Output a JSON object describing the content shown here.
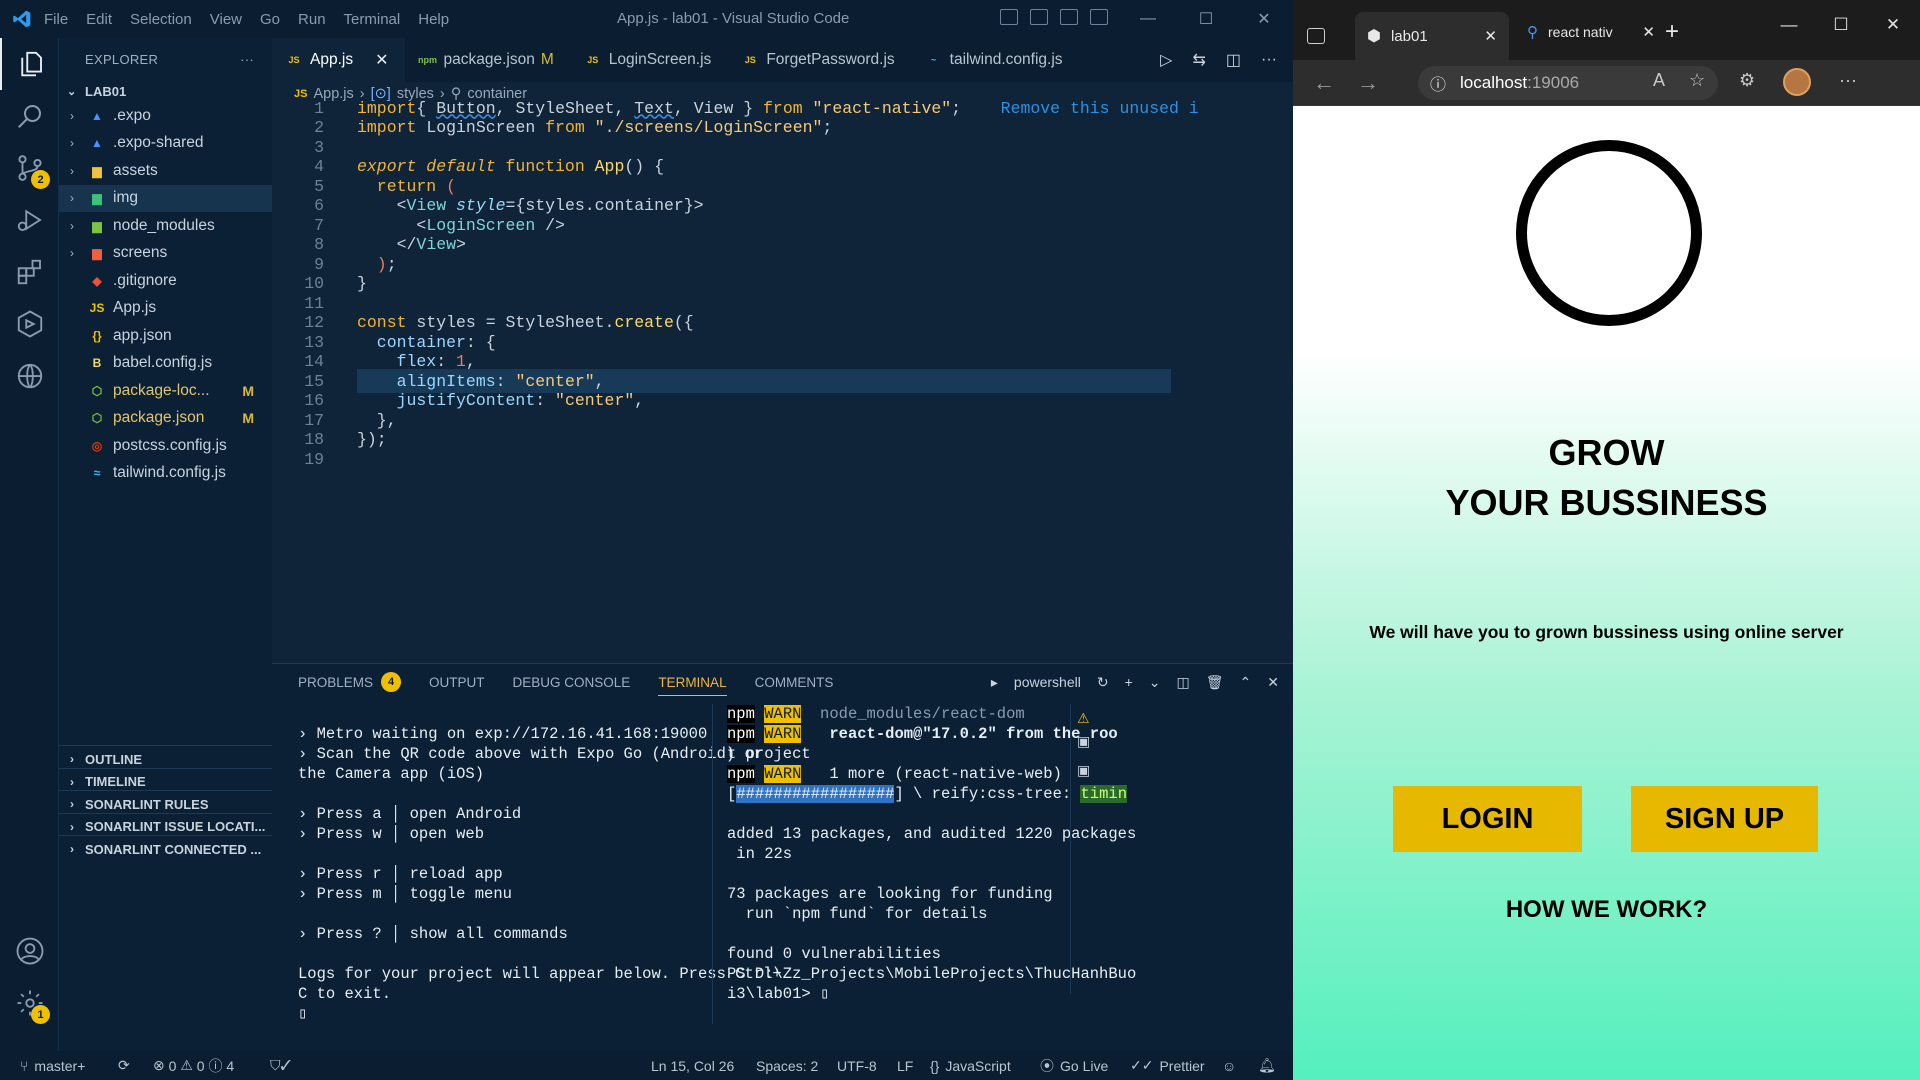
{
  "vscode": {
    "menu": [
      "File",
      "Edit",
      "Selection",
      "View",
      "Go",
      "Run",
      "Terminal",
      "Help"
    ],
    "title": "App.js - lab01 - Visual Studio Code",
    "activity": {
      "scm_badge": "2",
      "settings_badge": "1"
    },
    "explorer": {
      "header": "EXPLORER",
      "more": "···",
      "project": "LAB01",
      "items": [
        {
          "label": ".expo",
          "icon": "expo-folder-icon",
          "color": "#4a90ff",
          "chev": "›"
        },
        {
          "label": ".expo-shared",
          "icon": "expo-folder-icon",
          "color": "#4a90ff",
          "chev": "›"
        },
        {
          "label": "assets",
          "icon": "folder-icon",
          "color": "#f0c040",
          "chev": "›"
        },
        {
          "label": "img",
          "icon": "image-folder-icon",
          "color": "#3cc27a",
          "chev": "›"
        },
        {
          "label": "node_modules",
          "icon": "node-folder-icon",
          "color": "#7cc243",
          "chev": "›"
        },
        {
          "label": "screens",
          "icon": "folder-icon",
          "color": "#f06040",
          "chev": "›"
        },
        {
          "label": ".gitignore",
          "icon": "git-icon",
          "color": "#f05033",
          "chev": ""
        },
        {
          "label": "App.js",
          "icon": "js-icon",
          "color": "#f0c000",
          "chev": ""
        },
        {
          "label": "app.json",
          "icon": "json-icon",
          "color": "#f0c000",
          "chev": ""
        },
        {
          "label": "babel.config.js",
          "icon": "babel-icon",
          "color": "#f5da55",
          "chev": ""
        },
        {
          "label": "package-loc...",
          "icon": "npm-icon",
          "color": "#7cc243",
          "chev": "",
          "mod": "M"
        },
        {
          "label": "package.json",
          "icon": "npm-icon",
          "color": "#7cc243",
          "chev": "",
          "mod": "M"
        },
        {
          "label": "postcss.config.js",
          "icon": "postcss-icon",
          "color": "#dd3a0a",
          "chev": ""
        },
        {
          "label": "tailwind.config.js",
          "icon": "tailwind-icon",
          "color": "#38bdf8",
          "chev": ""
        }
      ],
      "footer": [
        "OUTLINE",
        "TIMELINE",
        "SONARLINT RULES",
        "SONARLINT ISSUE LOCATI...",
        "SONARLINT CONNECTED ..."
      ]
    },
    "tabs": [
      {
        "label": "App.js",
        "icon": "JS",
        "color": "#f0c000",
        "active": true
      },
      {
        "label": "package.json",
        "icon": "npm",
        "color": "#7cc243",
        "mod": "M"
      },
      {
        "label": "LoginScreen.js",
        "icon": "JS",
        "color": "#f0c000"
      },
      {
        "label": "ForgetPassword.js",
        "icon": "JS",
        "color": "#f0c000"
      },
      {
        "label": "tailwind.config.js",
        "icon": "~",
        "color": "#38bdf8"
      }
    ],
    "breadcrumb": [
      "App.js",
      "styles",
      "container"
    ],
    "code_lines": [
      {
        "n": "1",
        "tokens": [
          [
            "kw",
            "import"
          ],
          [
            "",
            "{ "
          ],
          [
            "ul",
            "Button"
          ],
          [
            "",
            ", StyleSheet, "
          ],
          [
            "ul",
            "Text"
          ],
          [
            "",
            ", View } "
          ],
          [
            "kw",
            "from"
          ],
          [
            "str",
            " \"react-native\""
          ],
          [
            "",
            ";"
          ]
        ],
        "hint": "Remove this unused i"
      },
      {
        "n": "2",
        "tokens": [
          [
            "kw",
            "import"
          ],
          [
            "",
            " LoginScreen "
          ],
          [
            "kw",
            "from"
          ],
          [
            "str",
            " \"./screens/LoginScreen\""
          ],
          [
            "",
            ";"
          ]
        ]
      },
      {
        "n": "3",
        "tokens": []
      },
      {
        "n": "4",
        "tokens": [
          [
            "kw it",
            "export default"
          ],
          [
            "kw",
            " function"
          ],
          [
            "fn",
            " App"
          ],
          [
            "",
            "() {"
          ]
        ]
      },
      {
        "n": "5",
        "tokens": [
          [
            "kw",
            "  return"
          ],
          [
            "",
            ""
          ],
          [
            "kw2",
            " ("
          ]
        ]
      },
      {
        "n": "6",
        "tokens": [
          [
            "",
            "    <"
          ],
          [
            "cls",
            "View"
          ],
          [
            "prop it",
            " style"
          ],
          [
            "",
            "={styles.container}>"
          ]
        ]
      },
      {
        "n": "7",
        "tokens": [
          [
            "",
            "      <"
          ],
          [
            "cls",
            "LoginScreen"
          ],
          [
            "",
            " />"
          ]
        ]
      },
      {
        "n": "8",
        "tokens": [
          [
            "",
            "    </"
          ],
          [
            "cls",
            "View"
          ],
          [
            "",
            ">"
          ]
        ]
      },
      {
        "n": "9",
        "tokens": [
          [
            "kw2",
            "  )"
          ],
          [
            "",
            ";"
          ]
        ]
      },
      {
        "n": "10",
        "tokens": [
          [
            "",
            "}"
          ]
        ]
      },
      {
        "n": "11",
        "tokens": []
      },
      {
        "n": "12",
        "tokens": [
          [
            "kw",
            "const"
          ],
          [
            "",
            " styles = StyleSheet."
          ],
          [
            "fn",
            "create"
          ],
          [
            "",
            "({"
          ]
        ]
      },
      {
        "n": "13",
        "tokens": [
          [
            "prop",
            "  container"
          ],
          [
            "",
            ": {"
          ]
        ]
      },
      {
        "n": "14",
        "tokens": [
          [
            "prop",
            "    flex"
          ],
          [
            "",
            ": "
          ],
          [
            "num",
            "1"
          ],
          [
            "",
            ","
          ]
        ]
      },
      {
        "n": "15",
        "tokens": [
          [
            "prop",
            "    alignItems"
          ],
          [
            "",
            ": "
          ],
          [
            "str",
            "\"center\""
          ],
          [
            "",
            ","
          ]
        ],
        "current": true
      },
      {
        "n": "16",
        "tokens": [
          [
            "prop",
            "    justifyContent"
          ],
          [
            "",
            ": "
          ],
          [
            "str",
            "\"center\""
          ],
          [
            "",
            ","
          ]
        ]
      },
      {
        "n": "17",
        "tokens": [
          [
            "",
            "  },"
          ]
        ]
      },
      {
        "n": "18",
        "tokens": [
          [
            "",
            "});"
          ]
        ]
      },
      {
        "n": "19",
        "tokens": []
      }
    ],
    "panel": {
      "tabs": [
        "PROBLEMS",
        "OUTPUT",
        "DEBUG CONSOLE",
        "TERMINAL",
        "COMMENTS"
      ],
      "problems_count": "4",
      "shell": "powershell",
      "left_terminal": [
        "",
        "› Metro waiting on exp://172.16.41.168:19000",
        "› Scan the QR code above with Expo Go (Android) or",
        "the Camera app (iOS)",
        "",
        "› Press a │ open Android",
        "› Press w │ open web",
        "",
        "› Press r │ reload app",
        "› Press m │ toggle menu",
        "",
        "› Press ? │ show all commands",
        "",
        "Logs for your project will appear below. Press Ctrl+",
        "C to exit."
      ],
      "right_terminal": {
        "warn1_path": "  node_modules/react-dom",
        "warn2_text": "   react-dom@\"17.0.2\" from the roo",
        "warn2_cont": "t project",
        "warn3_text": "   1 more (react-native-web)",
        "progress": "#################",
        "progress_tail": "] \\ reify:css-tree: ",
        "timin": "timin",
        "lines": [
          "",
          "added 13 packages, and audited 1220 packages",
          " in 22s",
          "",
          "73 packages are looking for funding",
          "  run `npm fund` for details",
          "",
          "found 0 vulnerabilities",
          "PS D:\\Zz_Projects\\MobileProjects\\ThucHanhBuo",
          "i3\\lab01> "
        ],
        "npm": "npm",
        "warn": "WARN"
      }
    },
    "status": {
      "branch": "master+",
      "errors": "0",
      "warnings": "0",
      "info": "4",
      "position": "Ln 15, Col 26",
      "spaces": "Spaces: 2",
      "encoding": "UTF-8",
      "eol": "LF",
      "language": "JavaScript",
      "golive": "Go Live",
      "prettier": "Prettier"
    }
  },
  "browser": {
    "tab1": "lab01",
    "tab2": "react nativ",
    "url_host": "localhost",
    "url_port": ":19006",
    "page": {
      "title_line1": "GROW",
      "title_line2": "YOUR BUSSINESS",
      "tagline": "We will have you to grown bussiness using online server",
      "login": "LOGIN",
      "signup": "SIGN UP",
      "how": "HOW WE WORK?"
    }
  }
}
